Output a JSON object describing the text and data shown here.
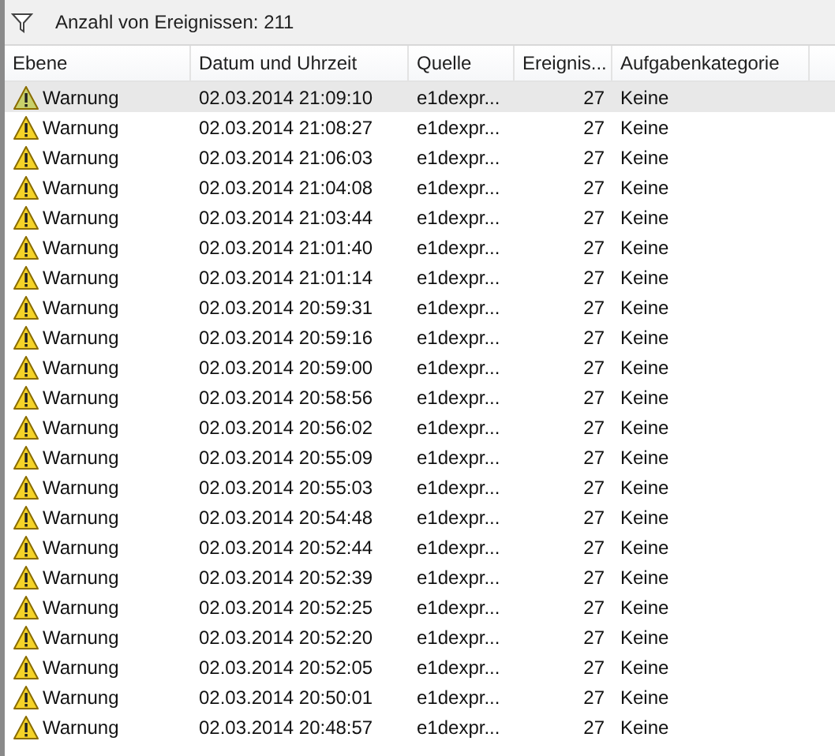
{
  "filter_bar": {
    "text": "Anzahl von Ereignissen: 211"
  },
  "table": {
    "columns": [
      "Ebene",
      "Datum und Uhrzeit",
      "Quelle",
      "Ereignis...",
      "Aufgabenkategorie"
    ],
    "rows": [
      {
        "level": "Warnung",
        "date": "02.03.2014 21:09:10",
        "source": "e1dexpr...",
        "event_id": "27",
        "category": "Keine",
        "selected": true
      },
      {
        "level": "Warnung",
        "date": "02.03.2014 21:08:27",
        "source": "e1dexpr...",
        "event_id": "27",
        "category": "Keine",
        "selected": false
      },
      {
        "level": "Warnung",
        "date": "02.03.2014 21:06:03",
        "source": "e1dexpr...",
        "event_id": "27",
        "category": "Keine",
        "selected": false
      },
      {
        "level": "Warnung",
        "date": "02.03.2014 21:04:08",
        "source": "e1dexpr...",
        "event_id": "27",
        "category": "Keine",
        "selected": false
      },
      {
        "level": "Warnung",
        "date": "02.03.2014 21:03:44",
        "source": "e1dexpr...",
        "event_id": "27",
        "category": "Keine",
        "selected": false
      },
      {
        "level": "Warnung",
        "date": "02.03.2014 21:01:40",
        "source": "e1dexpr...",
        "event_id": "27",
        "category": "Keine",
        "selected": false
      },
      {
        "level": "Warnung",
        "date": "02.03.2014 21:01:14",
        "source": "e1dexpr...",
        "event_id": "27",
        "category": "Keine",
        "selected": false
      },
      {
        "level": "Warnung",
        "date": "02.03.2014 20:59:31",
        "source": "e1dexpr...",
        "event_id": "27",
        "category": "Keine",
        "selected": false
      },
      {
        "level": "Warnung",
        "date": "02.03.2014 20:59:16",
        "source": "e1dexpr...",
        "event_id": "27",
        "category": "Keine",
        "selected": false
      },
      {
        "level": "Warnung",
        "date": "02.03.2014 20:59:00",
        "source": "e1dexpr...",
        "event_id": "27",
        "category": "Keine",
        "selected": false
      },
      {
        "level": "Warnung",
        "date": "02.03.2014 20:58:56",
        "source": "e1dexpr...",
        "event_id": "27",
        "category": "Keine",
        "selected": false
      },
      {
        "level": "Warnung",
        "date": "02.03.2014 20:56:02",
        "source": "e1dexpr...",
        "event_id": "27",
        "category": "Keine",
        "selected": false
      },
      {
        "level": "Warnung",
        "date": "02.03.2014 20:55:09",
        "source": "e1dexpr...",
        "event_id": "27",
        "category": "Keine",
        "selected": false
      },
      {
        "level": "Warnung",
        "date": "02.03.2014 20:55:03",
        "source": "e1dexpr...",
        "event_id": "27",
        "category": "Keine",
        "selected": false
      },
      {
        "level": "Warnung",
        "date": "02.03.2014 20:54:48",
        "source": "e1dexpr...",
        "event_id": "27",
        "category": "Keine",
        "selected": false
      },
      {
        "level": "Warnung",
        "date": "02.03.2014 20:52:44",
        "source": "e1dexpr...",
        "event_id": "27",
        "category": "Keine",
        "selected": false
      },
      {
        "level": "Warnung",
        "date": "02.03.2014 20:52:39",
        "source": "e1dexpr...",
        "event_id": "27",
        "category": "Keine",
        "selected": false
      },
      {
        "level": "Warnung",
        "date": "02.03.2014 20:52:25",
        "source": "e1dexpr...",
        "event_id": "27",
        "category": "Keine",
        "selected": false
      },
      {
        "level": "Warnung",
        "date": "02.03.2014 20:52:20",
        "source": "e1dexpr...",
        "event_id": "27",
        "category": "Keine",
        "selected": false
      },
      {
        "level": "Warnung",
        "date": "02.03.2014 20:52:05",
        "source": "e1dexpr...",
        "event_id": "27",
        "category": "Keine",
        "selected": false
      },
      {
        "level": "Warnung",
        "date": "02.03.2014 20:50:01",
        "source": "e1dexpr...",
        "event_id": "27",
        "category": "Keine",
        "selected": false
      },
      {
        "level": "Warnung",
        "date": "02.03.2014 20:48:57",
        "source": "e1dexpr...",
        "event_id": "27",
        "category": "Keine",
        "selected": false
      }
    ]
  }
}
